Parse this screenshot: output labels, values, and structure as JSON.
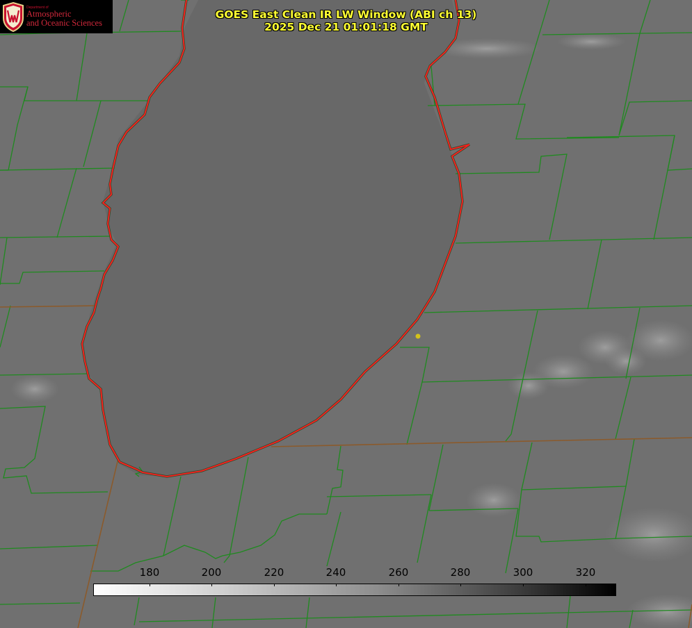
{
  "logo": {
    "department": "Department of",
    "line1": "Atmospheric",
    "line2": "and Oceanic Sciences"
  },
  "title": {
    "line1": "GOES East Clean IR LW Window (ABI ch 13)",
    "line2": "2025 Dec 21 01:01:18 GMT"
  },
  "colorbar": {
    "ticks": [
      "180",
      "200",
      "220",
      "240",
      "260",
      "280",
      "300",
      "320"
    ],
    "gradient": [
      "#ffffff",
      "#000000"
    ]
  },
  "colors": {
    "county_lines": "#1f8a1f",
    "coastline": "#ff1e1e",
    "state_lines": "#a0522d",
    "title_text": "#ffff33",
    "marker": "#d4c21a"
  }
}
